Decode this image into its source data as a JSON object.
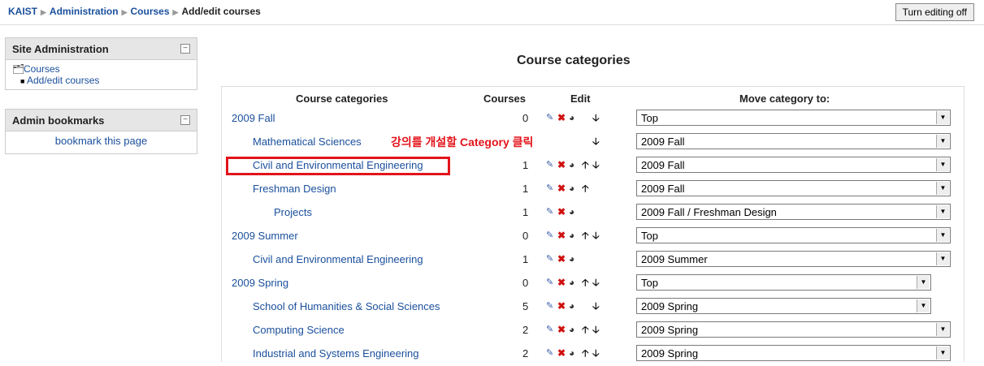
{
  "breadcrumb": [
    "KAIST",
    "Administration",
    "Courses",
    "Add/edit courses"
  ],
  "editing_button": "Turn editing off",
  "sidebar": {
    "site_admin": {
      "title": "Site Administration",
      "folder": "Courses",
      "item": "Add/edit courses"
    },
    "bookmarks": {
      "title": "Admin bookmarks",
      "link": "bookmark this page"
    }
  },
  "page_title": "Course categories",
  "table": {
    "headers": {
      "categories": "Course categories",
      "courses": "Courses",
      "edit": "Edit",
      "move": "Move category to:"
    },
    "rows": [
      {
        "name": "2009 Fall",
        "courses": "0",
        "move": "Top"
      },
      {
        "name": "Mathematical Sciences",
        "courses": "",
        "move": "2009 Fall"
      },
      {
        "name": "Civil and Environmental Engineering",
        "courses": "1",
        "move": "2009 Fall"
      },
      {
        "name": "Freshman Design",
        "courses": "1",
        "move": "2009 Fall"
      },
      {
        "name": "Projects",
        "courses": "1",
        "move": "2009 Fall / Freshman Design"
      },
      {
        "name": "2009 Summer",
        "courses": "0",
        "move": "Top"
      },
      {
        "name": "Civil and Environmental Engineering",
        "courses": "1",
        "move": "2009 Summer"
      },
      {
        "name": "2009 Spring",
        "courses": "0",
        "move": "Top"
      },
      {
        "name": "School of Humanities & Social Sciences",
        "courses": "5",
        "move": "2009 Spring"
      },
      {
        "name": "Computing Science",
        "courses": "2",
        "move": "2009 Spring"
      },
      {
        "name": "Industrial and Systems Engineering",
        "courses": "2",
        "move": "2009 Spring"
      }
    ]
  },
  "annotation": "강의를 개설할 Category 클릭",
  "colors": {
    "link": "#1a4f9c",
    "annotation": "#e3141b",
    "delete_icon": "#d01010"
  },
  "icons": {
    "edit": "edit-icon",
    "delete": "delete-icon",
    "hide": "hide-eye-icon",
    "up": "move-up-icon",
    "down": "move-down-icon"
  }
}
